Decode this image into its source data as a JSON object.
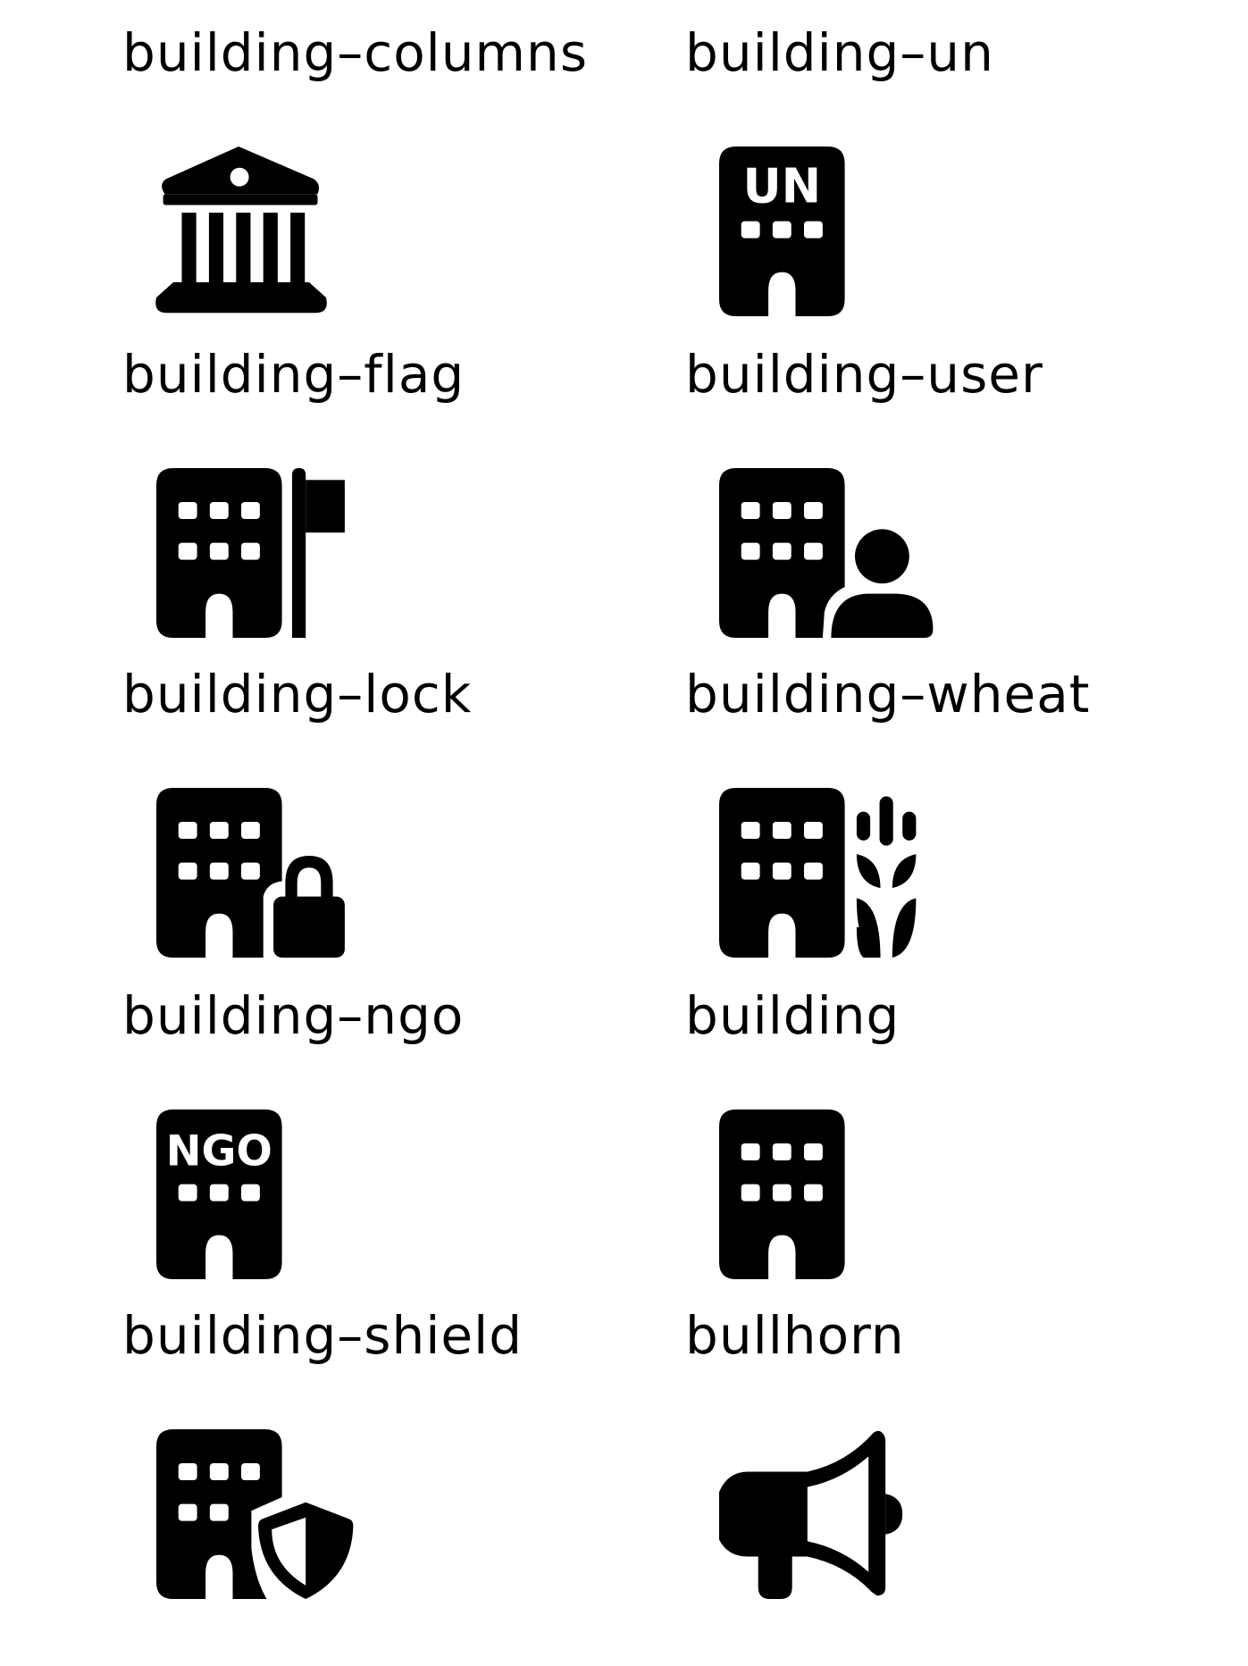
{
  "icons": [
    {
      "label": "building–columns",
      "icon": "building-columns-icon"
    },
    {
      "label": "building–un",
      "icon": "building-un-icon"
    },
    {
      "label": "building–flag",
      "icon": "building-flag-icon"
    },
    {
      "label": "building–user",
      "icon": "building-user-icon"
    },
    {
      "label": "building–lock",
      "icon": "building-lock-icon"
    },
    {
      "label": "building–wheat",
      "icon": "building-wheat-icon"
    },
    {
      "label": "building–ngo",
      "icon": "building-ngo-icon"
    },
    {
      "label": "building",
      "icon": "building-icon"
    },
    {
      "label": "building–shield",
      "icon": "building-shield-icon"
    },
    {
      "label": "bullhorn",
      "icon": "bullhorn-icon"
    }
  ],
  "colors": {
    "foreground": "#000000",
    "background": "#ffffff"
  },
  "icon_text": {
    "un": "UN",
    "ngo": "NGO"
  }
}
